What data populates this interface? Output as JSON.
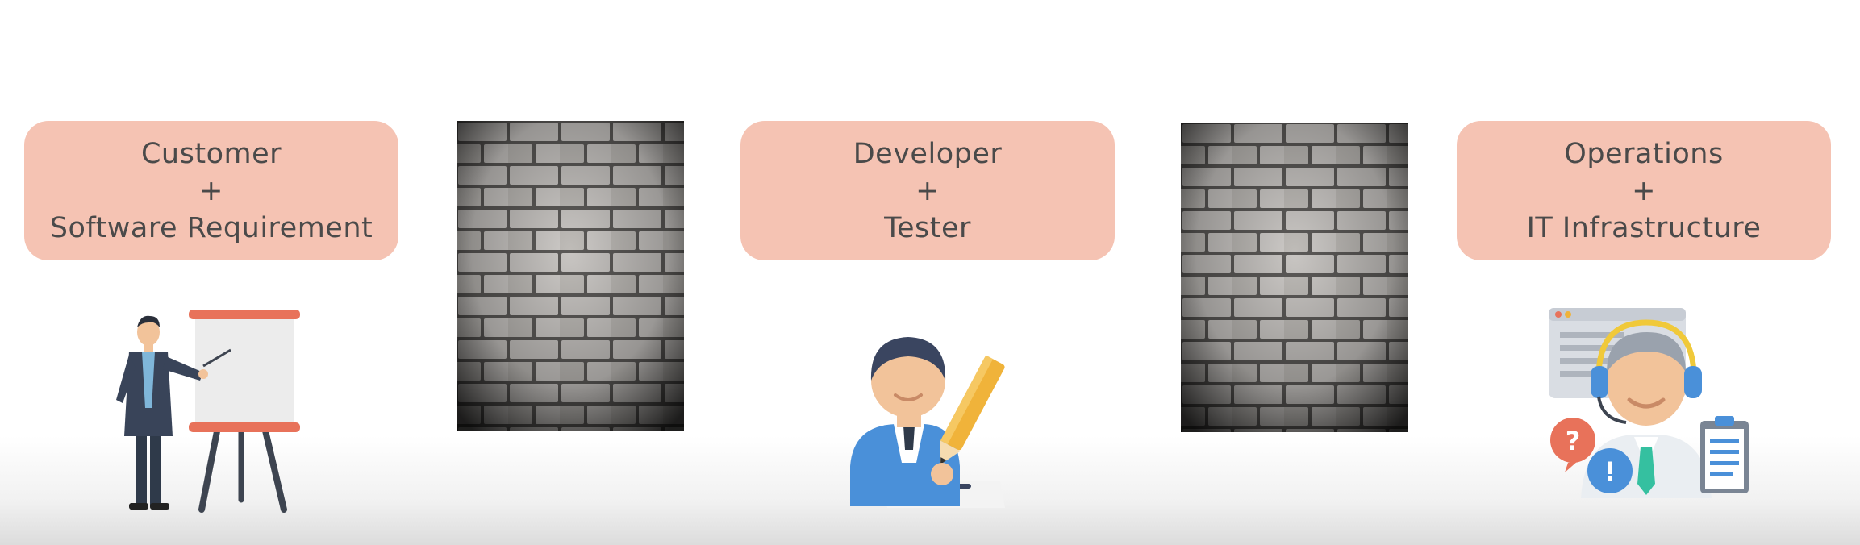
{
  "columns": [
    {
      "lines": [
        "Customer",
        "+",
        "Software Requirement"
      ],
      "icon": "presenter-icon"
    },
    {
      "lines": [
        "Developer",
        "+",
        "Tester"
      ],
      "icon": "developer-writing-icon"
    },
    {
      "lines": [
        "Operations",
        "+",
        "IT Infrastructure"
      ],
      "icon": "support-agent-icon"
    }
  ],
  "walls": [
    "brick-wall",
    "brick-wall"
  ],
  "colors": {
    "box_fill": "#f5c3b3",
    "text": "#4a4a4a",
    "easel_accent": "#e8725a",
    "pencil": "#f0b33a",
    "shirt_blue": "#4a90d9"
  }
}
